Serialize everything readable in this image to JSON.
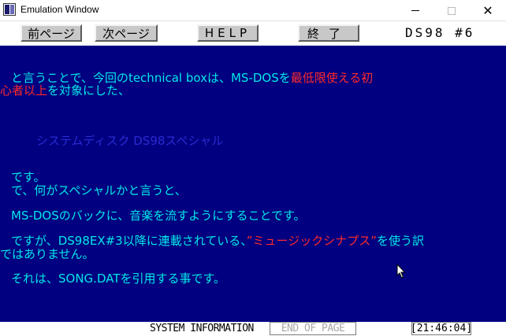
{
  "window": {
    "title": "Emulation Window",
    "icon": "app-icon",
    "min_icon": "minimize-icon",
    "max_icon": "maximize-icon",
    "close_glyph": "✕"
  },
  "toolbar": {
    "prev_label": "前ページ",
    "next_label": "次ページ",
    "help_label": "HELP",
    "quit_label": "終了",
    "page_id": "DS98 #6"
  },
  "content": {
    "line1": {
      "a": "と言うことで、今回のtechnical box",
      "b": "は、MS-DOSを",
      "c": "最低限使える初"
    },
    "line2": {
      "a": "心者以上",
      "b": "を対象にした、"
    },
    "line3": "システムディスク DS98スペシャル",
    "line4": "です。",
    "line5": "で、何がスペシャルかと言うと、",
    "line6": "MS-DOSのバックに、音楽を流すようにすることです。",
    "line7": {
      "a": "ですが、DS98EX#3以降に連載されている、",
      "b": "”ミュージックシナプス”",
      "c": "を使う訳"
    },
    "line8": "ではありません。",
    "line9": "それは、SONG.DATを引用する事です。"
  },
  "status": {
    "system_info": "SYSTEM INFORMATION",
    "end_page": "END OF PAGE",
    "clock": "21:46:04"
  },
  "colors": {
    "screen_bg": "#000080",
    "text_cyan": "#00e8e8",
    "text_red": "#ff2a2a",
    "text_blue": "#2a2ad4"
  }
}
